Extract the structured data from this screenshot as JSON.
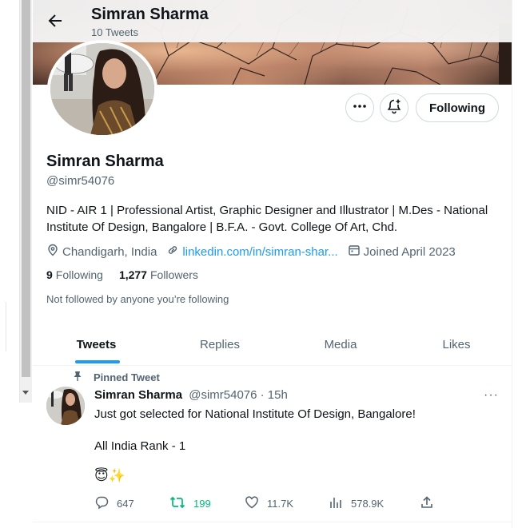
{
  "header": {
    "name": "Simran Sharma",
    "tweet_count": "10 Tweets"
  },
  "profile": {
    "name": "Simran Sharma",
    "handle": "@simr54076",
    "bio": "NID - AIR 1 | Professional Artist, Graphic Designer and Illustrator | M.Des - National Institute Of Design, Bangalore | B.F.A. - Govt. College Of Art, Chd.",
    "location": "Chandigarh, India",
    "website": "linkedin.com/in/simran-shar...",
    "joined": "Joined April 2023",
    "following_count": "9",
    "following_label": "Following",
    "followers_count": "1,277",
    "followers_label": "Followers",
    "not_followed": "Not followed by anyone you’re following"
  },
  "buttons": {
    "following": "Following"
  },
  "tabs": [
    {
      "label": "Tweets",
      "active": true
    },
    {
      "label": "Replies",
      "active": false
    },
    {
      "label": "Media",
      "active": false
    },
    {
      "label": "Likes",
      "active": false
    }
  ],
  "tweet": {
    "pinned_label": "Pinned Tweet",
    "author": "Simran Sharma",
    "meta": "@simr54076 · 15h",
    "more": "···",
    "line1": "Just got selected for National Institute Of Design, Bangalore!",
    "line2": "All India Rank - 1",
    "emoji": "😇✨",
    "replies": "647",
    "retweets": "199",
    "likes": "11.7K",
    "views": "578.9K"
  },
  "colors": {
    "accent": "#1d9bf0",
    "retweet": "#00ba7c",
    "secondary_text": "#536471",
    "primary_text": "#0f1419"
  },
  "icons": [
    "back-arrow-icon",
    "more-icon",
    "bell-plus-icon",
    "location-icon",
    "link-icon",
    "calendar-icon",
    "pin-icon",
    "reply-icon",
    "retweet-icon",
    "like-icon",
    "views-icon",
    "share-icon"
  ]
}
